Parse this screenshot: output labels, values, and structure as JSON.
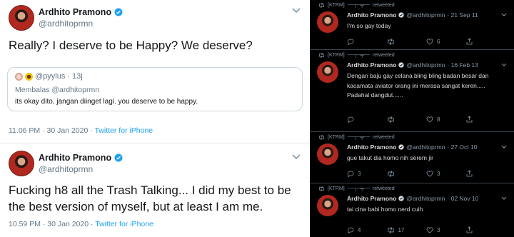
{
  "left": {
    "tweets": [
      {
        "name": "Ardhito Pramono",
        "handle": "@ardhitoprmn",
        "text": "Really? I deserve to be Happy? We deserve?",
        "quote": {
          "handle": "@pyylus",
          "time": "13j",
          "reply_to": "Membalas @ardhitoprmn",
          "text": "its okay dito, jangan diinget lagi. you deserve to be happy."
        },
        "timestamp": "11.06 PM · 30 Jan 2020 · ",
        "source": "Twitter for iPhone"
      },
      {
        "name": "Ardhito Pramono",
        "handle": "@ardhitoprmn",
        "text": "Fucking h8 all the Trash Talking... I did my best to be the best version of myself, but at least I am me.",
        "timestamp": "10.59 PM · 30 Jan 2020 · ",
        "source": "Twitter for iPhone"
      }
    ]
  },
  "right": {
    "tweets": [
      {
        "retweeter": "[KTRM]",
        "retweet_suffix": "retweeted",
        "name": "Ardhito Pramono",
        "handle": "@ardhitoprmn",
        "date": "· 21 Sep 11",
        "text": "I'm so gay today",
        "replies": "",
        "retweets": "",
        "likes": "6"
      },
      {
        "retweeter": "[KTRM]",
        "retweet_suffix": "retweeted",
        "name": "Ardhito Pramono",
        "handle": "@ardhitoprmn",
        "date": "· 16 Feb 13",
        "text": "Dengan baju gay celana bling bling badan besar dan kacamata aviator orang ini merasa sangat keren..... Padahal dangdut......",
        "replies": "",
        "retweets": "",
        "likes": "8"
      },
      {
        "retweeter": "[KTRM]",
        "retweet_suffix": "retweeted",
        "name": "Ardhito Pramono",
        "handle": "@ardhitoprmn",
        "date": "· 27 Oct 10",
        "text": "gue takut dia homo nih serem jir",
        "replies": "3",
        "retweets": "",
        "likes": "3"
      },
      {
        "retweeter": "[KTRM]",
        "retweet_suffix": "retweeted",
        "name": "Ardhito Pramono",
        "handle": "@ardhitoprmn",
        "date": "· 02 Nov 10",
        "text": "tai cina babi homo nerd cuih",
        "replies": "4",
        "retweets": "17",
        "likes": "3"
      }
    ]
  },
  "colors": {
    "link_blue": "#1da1f2",
    "muted_gray": "#657786",
    "dark_bg": "#000000",
    "dark_text": "#d9d9d9",
    "dark_muted": "#8899a6"
  },
  "icons": [
    "verified-badge-icon",
    "chevron-down-icon",
    "retweet-icon",
    "reply-icon",
    "like-icon",
    "share-icon"
  ]
}
